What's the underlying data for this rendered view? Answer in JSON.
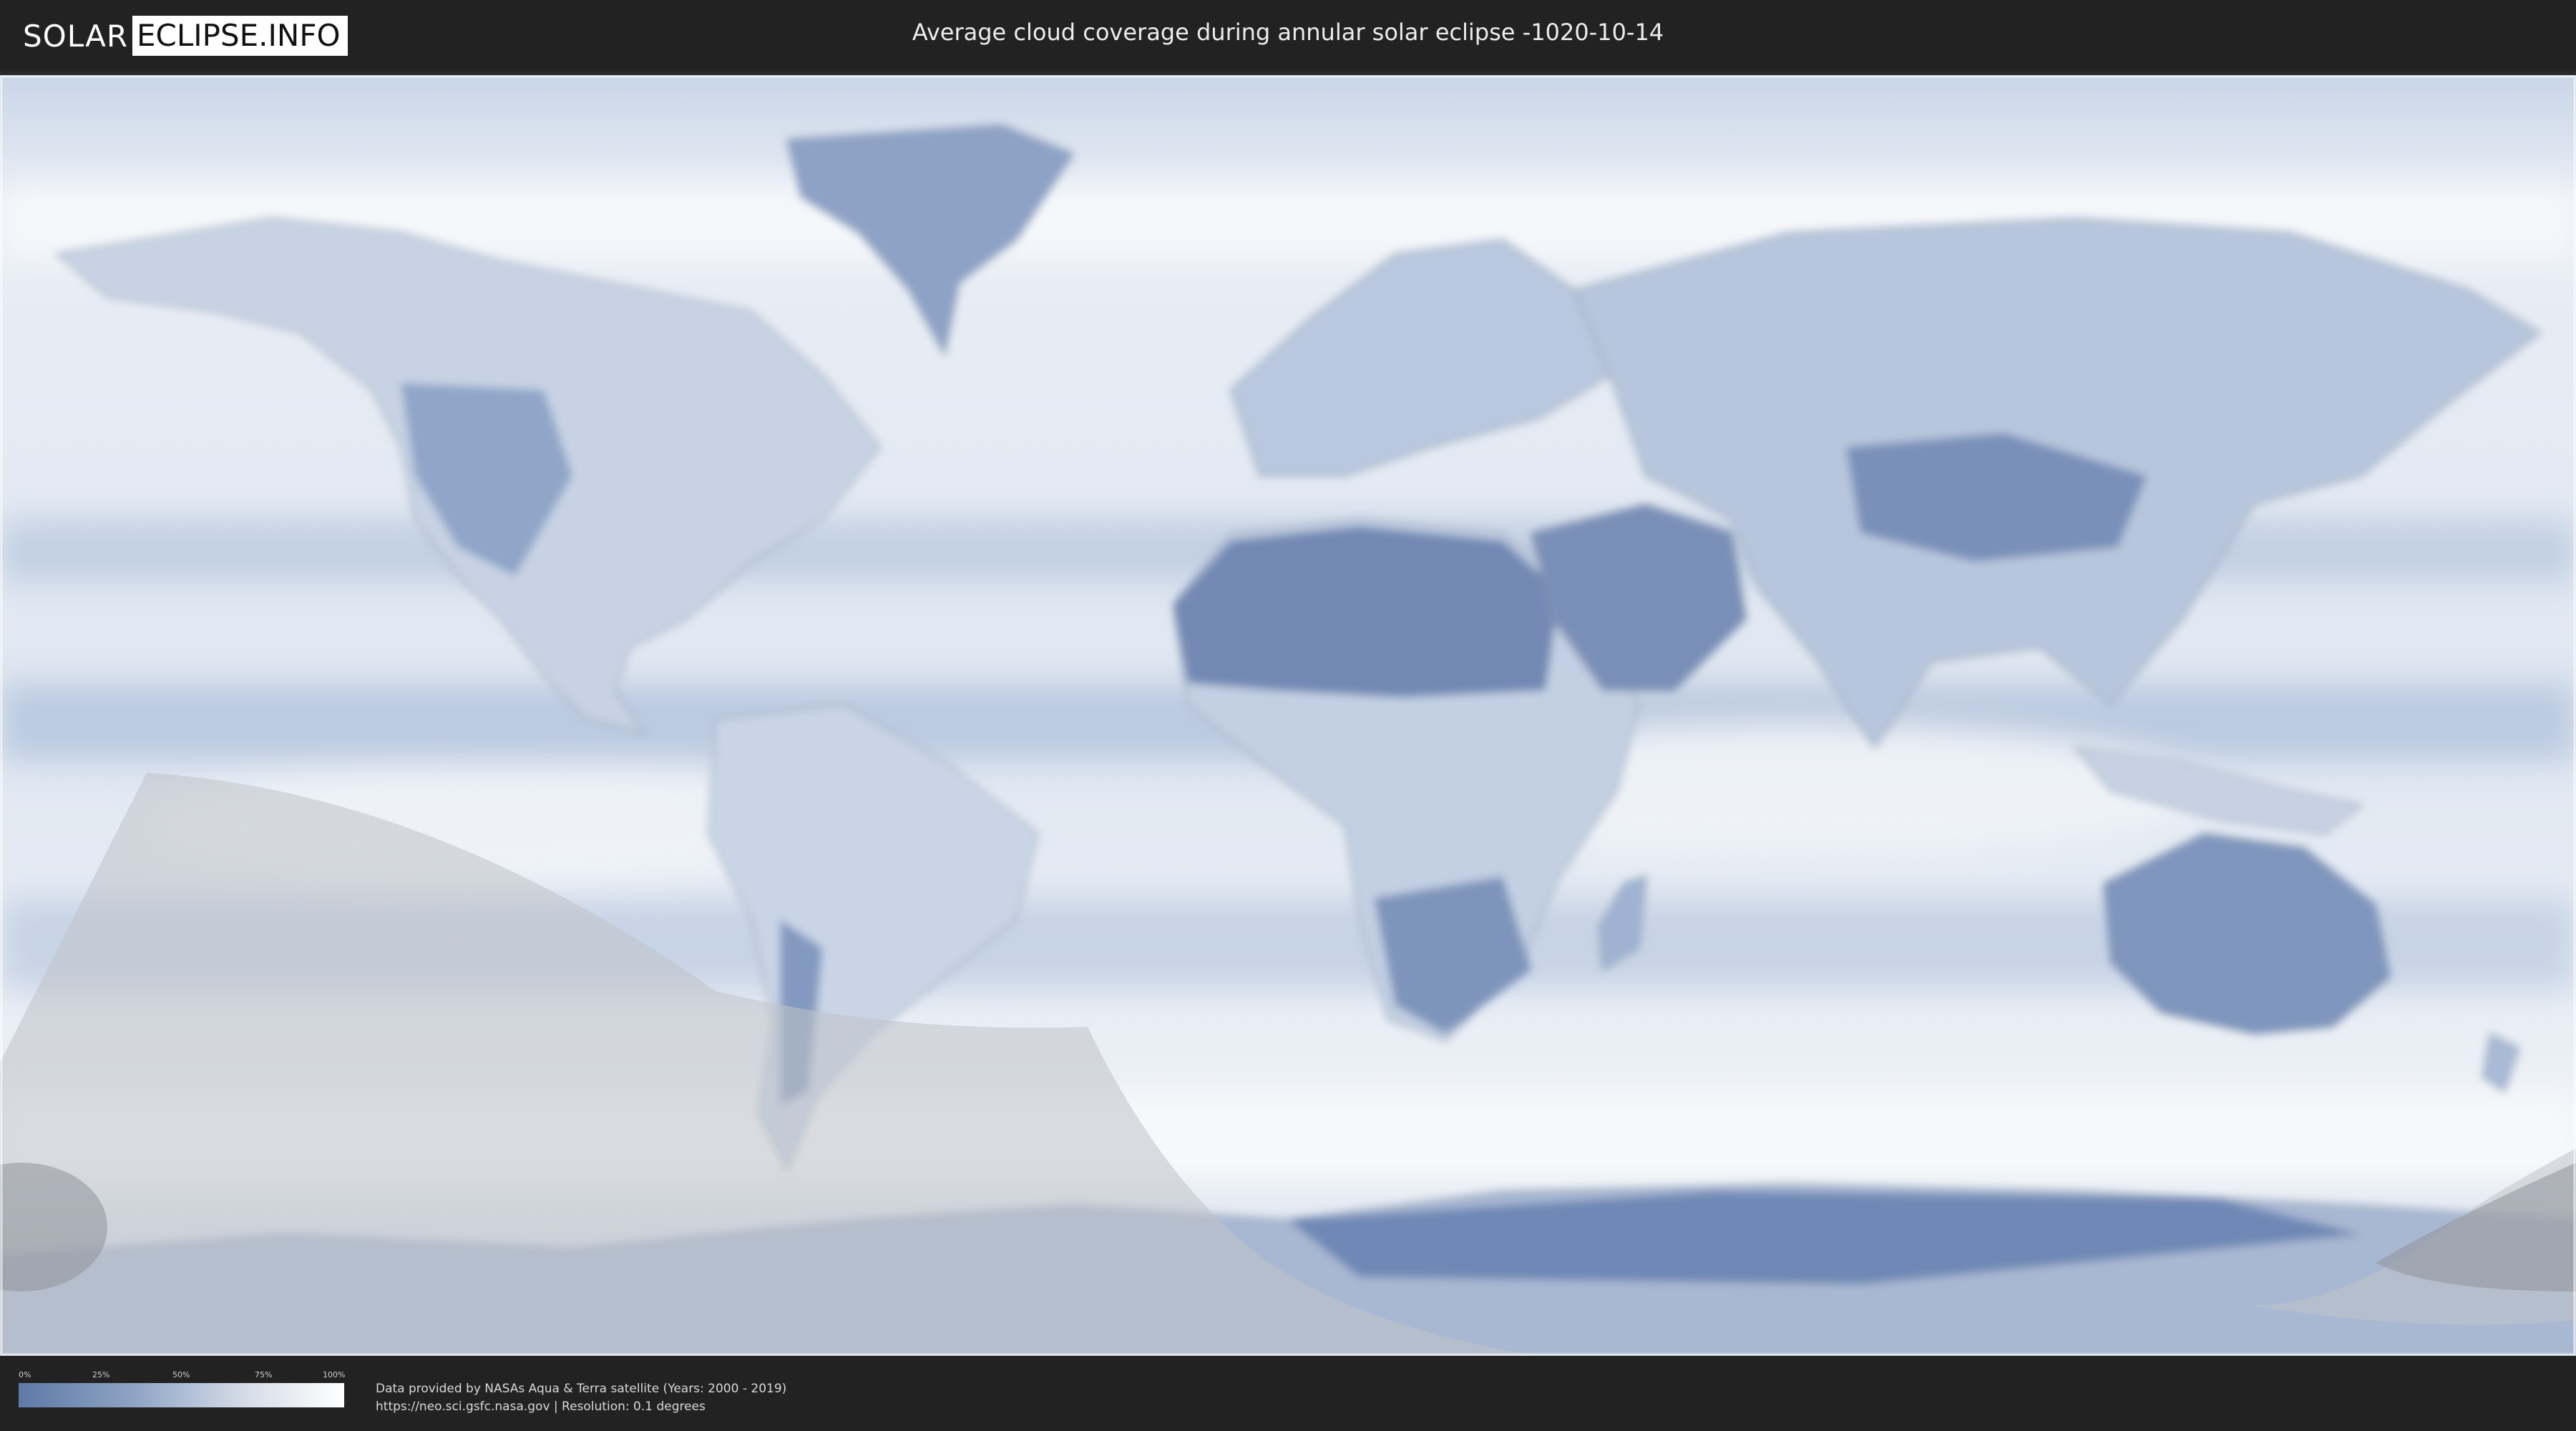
{
  "header": {
    "logo_solar": "SOLAR",
    "logo_eclipse": "ECLIPSE.INFO",
    "title": "Average cloud coverage during annular solar eclipse -1020-10-14"
  },
  "legend": {
    "ticks": [
      "0%",
      "25%",
      "50%",
      "75%",
      "100%"
    ],
    "gradient_colors": [
      "#5f7aa8",
      "#8ea3c4",
      "#d6dde8",
      "#ffffff"
    ]
  },
  "footer": {
    "credit_line1": "Data provided by NASAs Aqua & Terra satellite (Years: 2000 - 2019)",
    "credit_line2": "https://neo.sci.gsfc.nasa.gov | Resolution: 0.1 degrees"
  },
  "colors": {
    "land_clear": "#6f87b3",
    "cloud_white": "#f3f6fa",
    "eclipse_shade": "#bfc3c8"
  }
}
